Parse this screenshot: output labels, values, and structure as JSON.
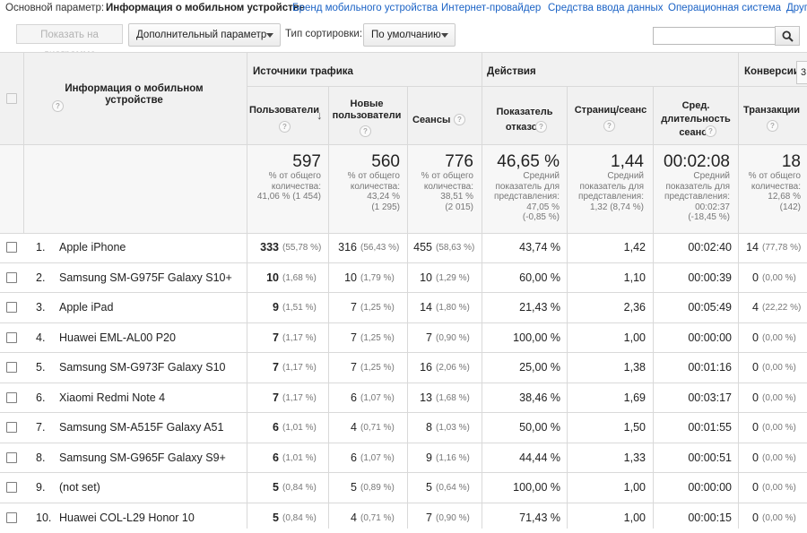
{
  "dimbar": {
    "label": "Основной параметр:",
    "active": "Информация о мобильном устройстве",
    "links": [
      "Бренд мобильного устройства",
      "Интернет-провайдер",
      "Средства ввода данных",
      "Операционная система",
      "Другие"
    ]
  },
  "toolbar": {
    "plot_button": "Показать на диаграмме",
    "secondary_dimension": "Дополнительный параметр",
    "sort_label": "Тип сортировки:",
    "sort_value": "По умолчанию",
    "search_value": ""
  },
  "table": {
    "dimension_header": "Информация о мобильном устройстве",
    "groups": {
      "traffic": "Источники трафика",
      "actions": "Действия",
      "conversions": "Конверсии"
    },
    "columns": {
      "users": "Пользователи",
      "new_users": "Новые пользователи",
      "sessions": "Сеансы",
      "bounce": "Показатель отказов",
      "pages": "Страниц/сеанс",
      "duration": "Сред. длительность сеанса",
      "transactions": "Транзакции"
    },
    "totals": {
      "users": {
        "value": "597",
        "l1": "% от общего",
        "l2": "количества:",
        "l3": "41,06 % (1 454)"
      },
      "new_users": {
        "value": "560",
        "l1": "% от общего",
        "l2": "количества:",
        "l3": "43,24 %",
        "l4": "(1 295)"
      },
      "sessions": {
        "value": "776",
        "l1": "% от общего",
        "l2": "количества:",
        "l3": "38,51 %",
        "l4": "(2 015)"
      },
      "bounce": {
        "value": "46,65 %",
        "l1": "Средний",
        "l2": "показатель для",
        "l3": "представления:",
        "l4": "47,05 %",
        "l5": "(-0,85 %)"
      },
      "pages": {
        "value": "1,44",
        "l1": "Средний",
        "l2": "показатель для",
        "l3": "представления:",
        "l4": "1,32 (8,74 %)"
      },
      "duration": {
        "value": "00:02:08",
        "l1": "Средний",
        "l2": "показатель для",
        "l3": "представления:",
        "l4": "00:02:37",
        "l5": "(-18,45 %)"
      },
      "transactions": {
        "value": "18",
        "l1": "% от общего",
        "l2": "количества:",
        "l3": "12,68 %",
        "l4": "(142)"
      }
    },
    "rows": [
      {
        "n": "1.",
        "device": "Apple iPhone",
        "users": "333",
        "users_pct": "(55,78 %)",
        "new": "316",
        "new_pct": "(56,43 %)",
        "sessions": "455",
        "sessions_pct": "(58,63 %)",
        "bounce": "43,74 %",
        "pages": "1,42",
        "duration": "00:02:40",
        "tx": "14",
        "tx_pct": "(77,78 %)"
      },
      {
        "n": "2.",
        "device": "Samsung SM-G975F Galaxy S10+",
        "users": "10",
        "users_pct": "(1,68 %)",
        "new": "10",
        "new_pct": "(1,79 %)",
        "sessions": "10",
        "sessions_pct": "(1,29 %)",
        "bounce": "60,00 %",
        "pages": "1,10",
        "duration": "00:00:39",
        "tx": "0",
        "tx_pct": "(0,00 %)"
      },
      {
        "n": "3.",
        "device": "Apple iPad",
        "users": "9",
        "users_pct": "(1,51 %)",
        "new": "7",
        "new_pct": "(1,25 %)",
        "sessions": "14",
        "sessions_pct": "(1,80 %)",
        "bounce": "21,43 %",
        "pages": "2,36",
        "duration": "00:05:49",
        "tx": "4",
        "tx_pct": "(22,22 %)"
      },
      {
        "n": "4.",
        "device": "Huawei EML-AL00 P20",
        "users": "7",
        "users_pct": "(1,17 %)",
        "new": "7",
        "new_pct": "(1,25 %)",
        "sessions": "7",
        "sessions_pct": "(0,90 %)",
        "bounce": "100,00 %",
        "pages": "1,00",
        "duration": "00:00:00",
        "tx": "0",
        "tx_pct": "(0,00 %)"
      },
      {
        "n": "5.",
        "device": "Samsung SM-G973F Galaxy S10",
        "users": "7",
        "users_pct": "(1,17 %)",
        "new": "7",
        "new_pct": "(1,25 %)",
        "sessions": "16",
        "sessions_pct": "(2,06 %)",
        "bounce": "25,00 %",
        "pages": "1,38",
        "duration": "00:01:16",
        "tx": "0",
        "tx_pct": "(0,00 %)"
      },
      {
        "n": "6.",
        "device": "Xiaomi Redmi Note 4",
        "users": "7",
        "users_pct": "(1,17 %)",
        "new": "6",
        "new_pct": "(1,07 %)",
        "sessions": "13",
        "sessions_pct": "(1,68 %)",
        "bounce": "38,46 %",
        "pages": "1,69",
        "duration": "00:03:17",
        "tx": "0",
        "tx_pct": "(0,00 %)"
      },
      {
        "n": "7.",
        "device": "Samsung SM-A515F Galaxy A51",
        "users": "6",
        "users_pct": "(1,01 %)",
        "new": "4",
        "new_pct": "(0,71 %)",
        "sessions": "8",
        "sessions_pct": "(1,03 %)",
        "bounce": "50,00 %",
        "pages": "1,50",
        "duration": "00:01:55",
        "tx": "0",
        "tx_pct": "(0,00 %)"
      },
      {
        "n": "8.",
        "device": "Samsung SM-G965F Galaxy S9+",
        "users": "6",
        "users_pct": "(1,01 %)",
        "new": "6",
        "new_pct": "(1,07 %)",
        "sessions": "9",
        "sessions_pct": "(1,16 %)",
        "bounce": "44,44 %",
        "pages": "1,33",
        "duration": "00:00:51",
        "tx": "0",
        "tx_pct": "(0,00 %)"
      },
      {
        "n": "9.",
        "device": "(not set)",
        "users": "5",
        "users_pct": "(0,84 %)",
        "new": "5",
        "new_pct": "(0,89 %)",
        "sessions": "5",
        "sessions_pct": "(0,64 %)",
        "bounce": "100,00 %",
        "pages": "1,00",
        "duration": "00:00:00",
        "tx": "0",
        "tx_pct": "(0,00 %)"
      },
      {
        "n": "10.",
        "device": "Huawei COL-L29 Honor 10",
        "users": "5",
        "users_pct": "(0,84 %)",
        "new": "4",
        "new_pct": "(0,71 %)",
        "sessions": "7",
        "sessions_pct": "(0,90 %)",
        "bounce": "71,43 %",
        "pages": "1,00",
        "duration": "00:00:15",
        "tx": "0",
        "tx_pct": "(0,00 %)"
      }
    ]
  },
  "icons": {
    "help": "?",
    "search": "search-icon",
    "sort": "↓"
  },
  "colors": {
    "link": "#1a62c5",
    "header_bg": "#f1f1f1",
    "border": "#d9d9d9"
  }
}
